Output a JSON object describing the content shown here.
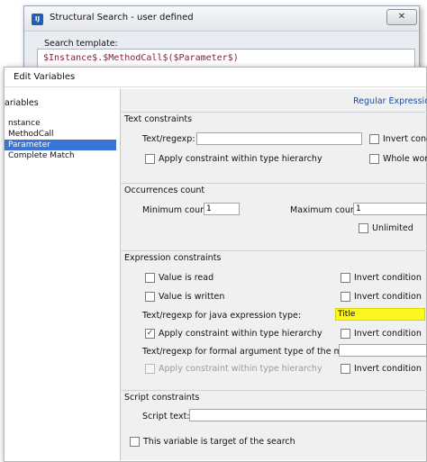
{
  "background_window": {
    "title": "Structural Search - user defined",
    "icon_text": "IJ",
    "close_glyph": "✕",
    "template_label": "Search template:",
    "template_code": "$Instance$.$MethodCall$($Parameter$)"
  },
  "dialog": {
    "title": "Edit Variables",
    "variables_header": "ariables",
    "variables": [
      {
        "label": "nstance",
        "selected": false
      },
      {
        "label": "MethodCall",
        "selected": false
      },
      {
        "label": "Parameter",
        "selected": true
      },
      {
        "label": "Complete Match",
        "selected": false
      }
    ],
    "regular_expression_link": "Regular Expression",
    "text_constraints": {
      "header": "Text constraints",
      "text_regexp_label": "Text/regexp:",
      "text_regexp_value": "",
      "invert_label": "Invert cond",
      "apply_hierarchy_label": "Apply constraint within type hierarchy",
      "whole_words_label": "Whole word"
    },
    "occurrences": {
      "header": "Occurrences count",
      "min_label": "Minimum count:",
      "min_value": "1",
      "max_label": "Maximum count:",
      "max_value": "1",
      "unlimited_label": "Unlimited"
    },
    "expression": {
      "header": "Expression constraints",
      "value_read_label": "Value is read",
      "value_written_label": "Value is written",
      "invert_condition_label": "Invert condition",
      "java_type_label": "Text/regexp for java expression type:",
      "java_type_value": "Title",
      "apply_hierarchy_label": "Apply constraint within type hierarchy",
      "formal_arg_label": "Text/regexp for formal argument type of the method:",
      "formal_arg_value": "",
      "apply_hierarchy_disabled_label": "Apply constraint within type hierarchy",
      "check_glyph": "✓"
    },
    "script": {
      "header": "Script constraints",
      "script_text_label": "Script text:",
      "script_text_value": ""
    },
    "target_label": "This variable is target of the search"
  }
}
